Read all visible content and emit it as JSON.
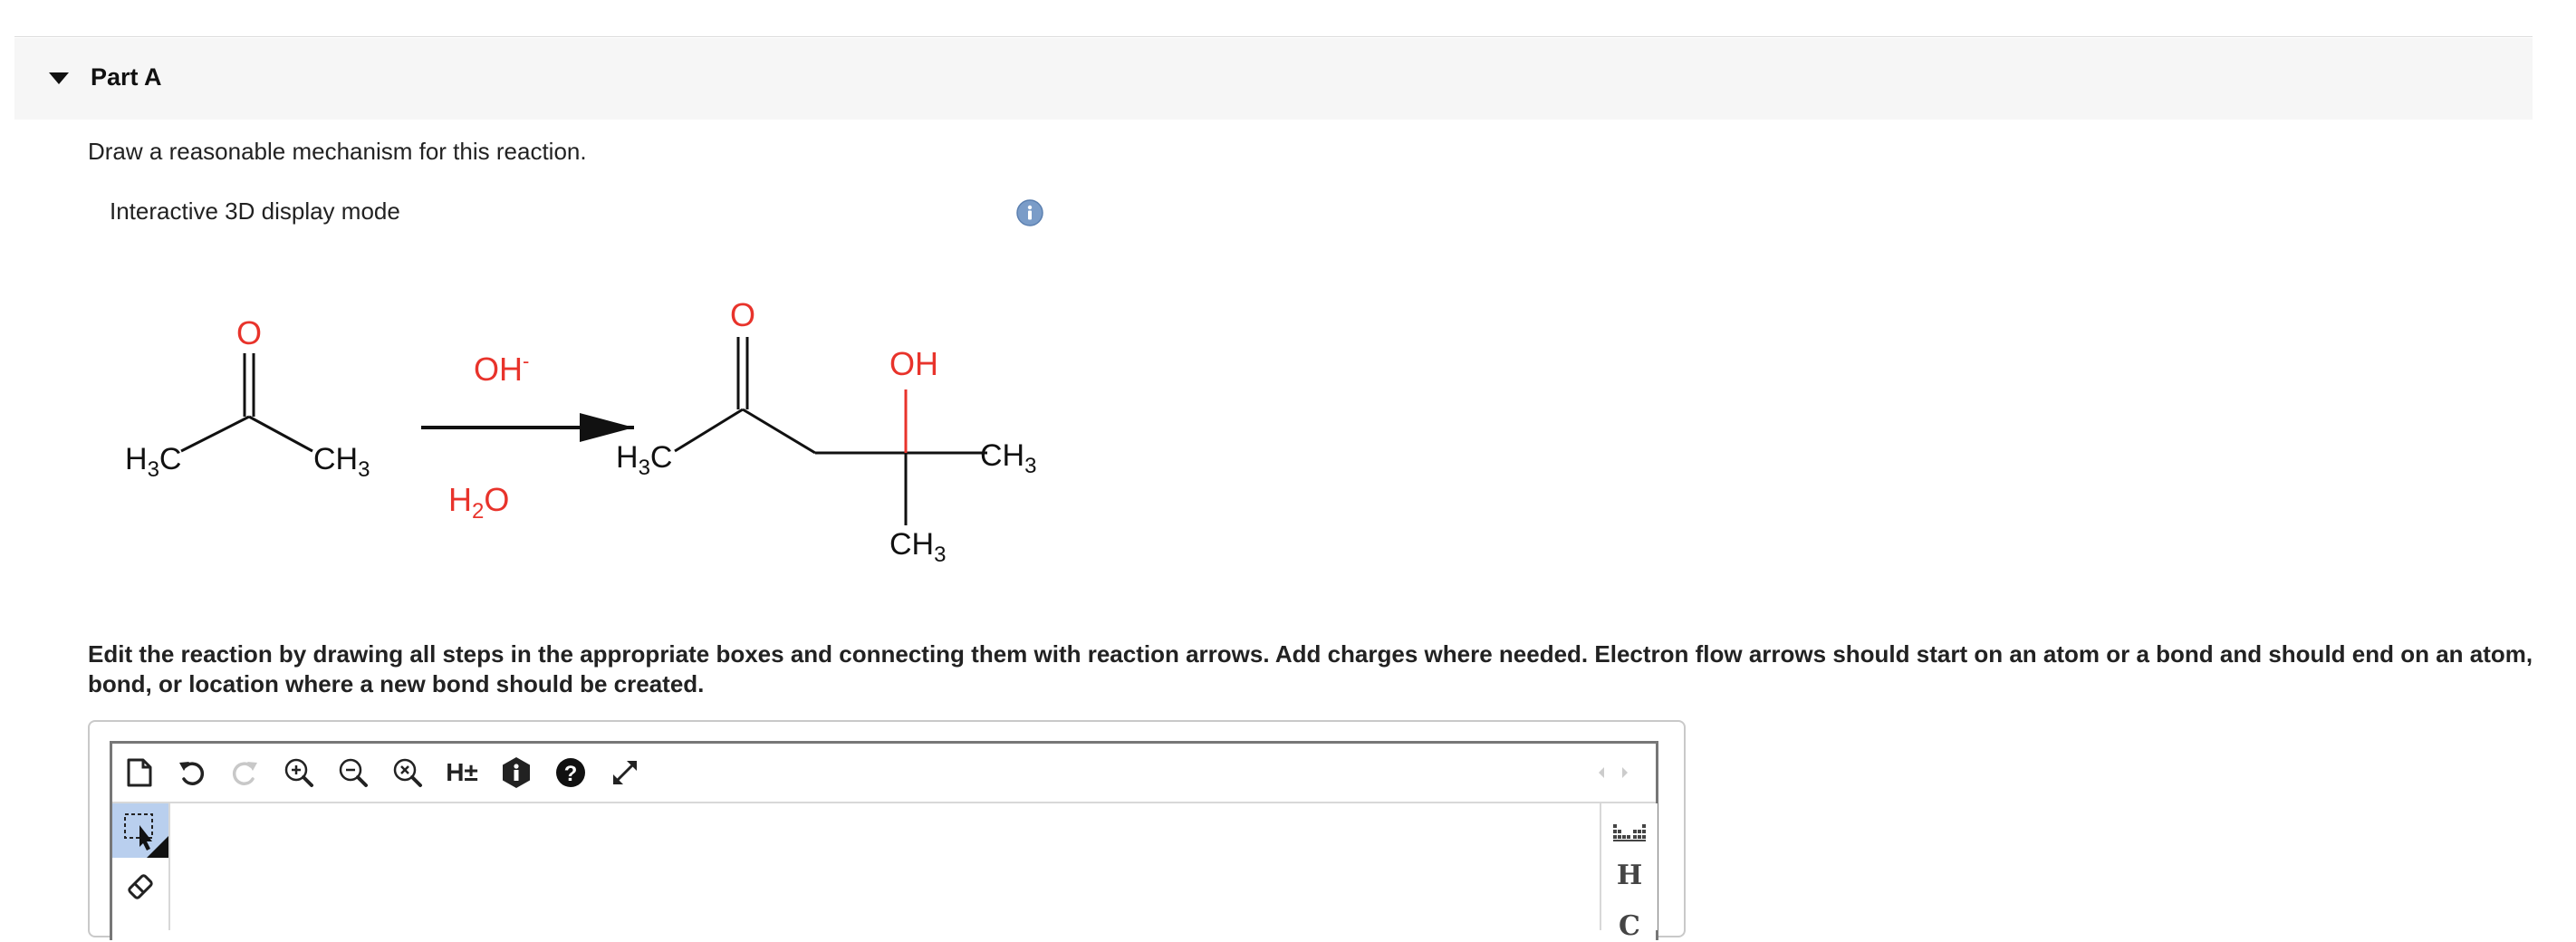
{
  "part": {
    "title": "Part A"
  },
  "prompt": "Draw a reasonable mechanism for this reaction.",
  "display_mode_label": "Interactive 3D display mode",
  "reaction": {
    "reactant": {
      "o": "O",
      "left_group_h": "H",
      "left_group_sub": "3",
      "left_group_c": "C",
      "right_group_ch": "CH",
      "right_group_sub": "3"
    },
    "reagent_above": {
      "base": "OH",
      "charge": "-"
    },
    "reagent_below": {
      "h": "H",
      "sub": "2",
      "o": "O"
    },
    "product": {
      "o": "O",
      "oh": "OH",
      "left_h": "H",
      "left_sub": "3",
      "left_c": "C",
      "right_ch": "CH",
      "right_sub": "3",
      "bottom_ch": "CH",
      "bottom_sub": "3"
    }
  },
  "instructions": "Edit the reaction by drawing all steps in the appropriate boxes and connecting them with reaction arrows. Add charges where needed. Electron flow arrows should start on an atom or a bond and should end on an atom, bond, or location where a new bond should be created.",
  "toolbar": {
    "tools": [
      "new-document",
      "undo",
      "redo",
      "zoom-in",
      "zoom-out",
      "zoom-reset",
      "explicit-hydrogens",
      "info",
      "help",
      "fullscreen"
    ],
    "h_toggle": "H±"
  },
  "element_palette": {
    "h": "H",
    "c": "C"
  },
  "colors": {
    "oxygen": "#e8332b",
    "info": "#7a9cc8",
    "selection": "#b9cfee"
  }
}
